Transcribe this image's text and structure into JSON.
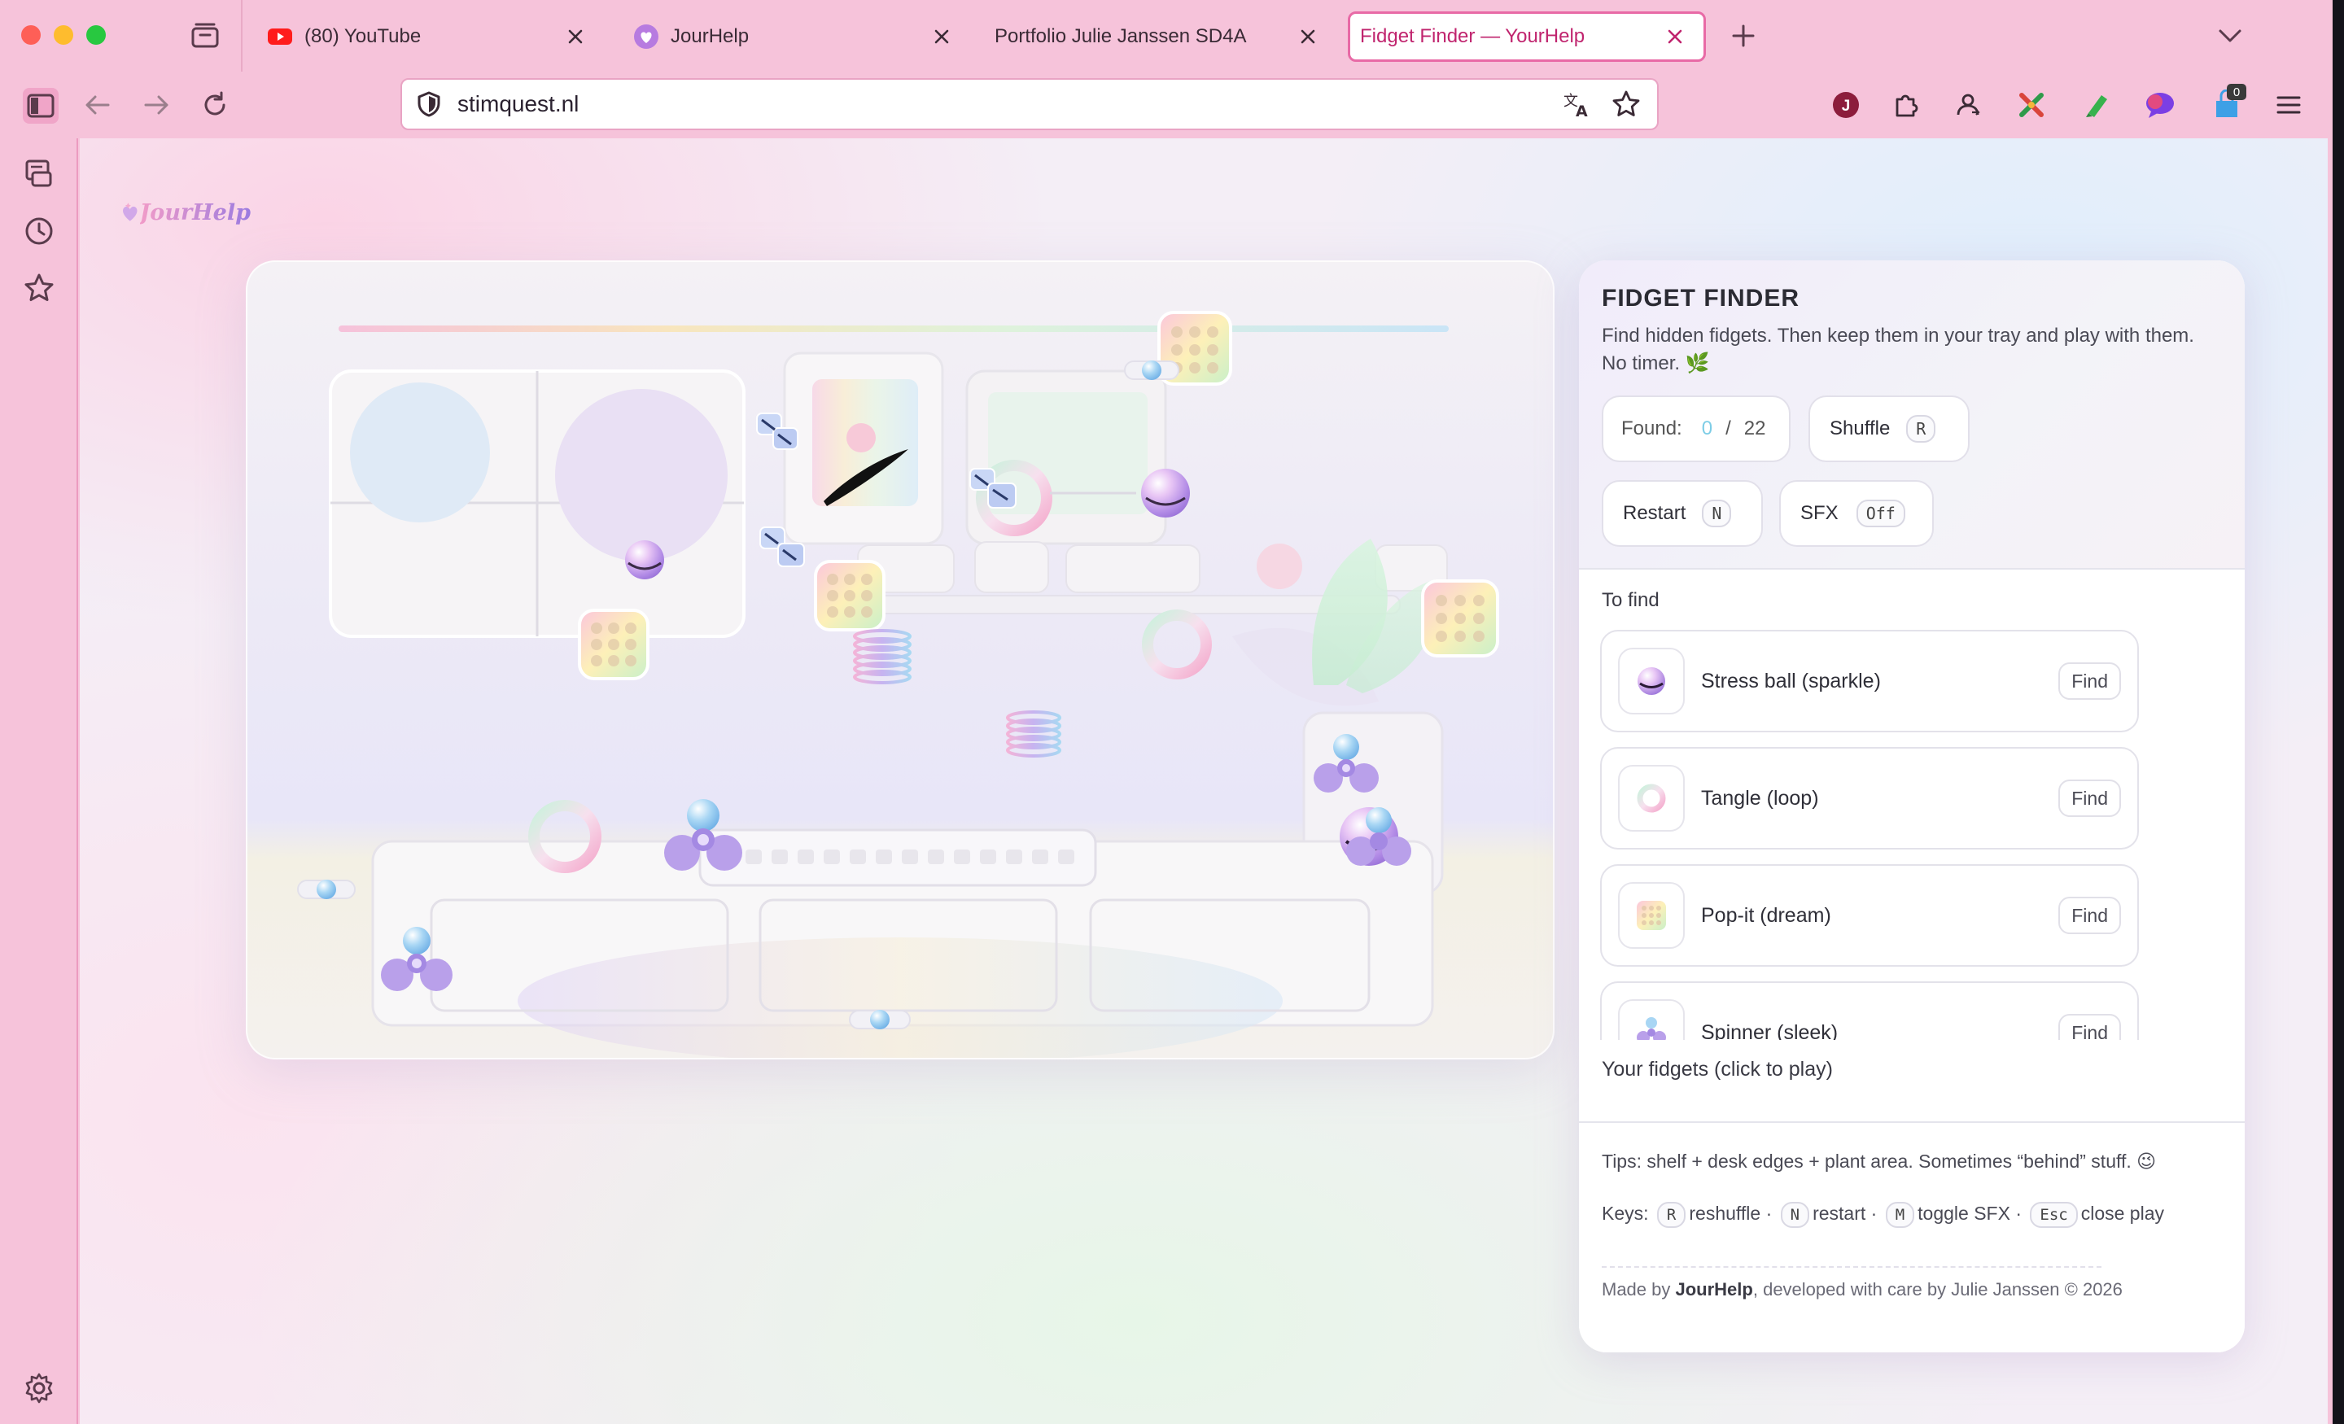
{
  "browser": {
    "tabs": [
      {
        "title": "(80) YouTube",
        "icon": "youtube-icon",
        "active": false
      },
      {
        "title": "JourHelp",
        "icon": "heart-icon",
        "active": false
      },
      {
        "title": "Portfolio Julie Janssen SD4A",
        "icon": "",
        "active": false
      },
      {
        "title": "Fidget Finder — YourHelp",
        "icon": "",
        "active": true
      }
    ],
    "url": "stimquest.nl",
    "extension_badge": "0",
    "accent_color": "#e86aa6",
    "chrome_color": "#f6c3da"
  },
  "page": {
    "logo_text": "JourHelp"
  },
  "panel": {
    "title": "FIDGET FINDER",
    "description": "Find hidden fidgets. Then keep them in your tray and play with them. No timer. 🌿",
    "found_label": "Found:",
    "found_count": "0",
    "found_sep": "/",
    "found_total": "22",
    "shuffle_label": "Shuffle",
    "shuffle_key": "R",
    "restart_label": "Restart",
    "restart_key": "N",
    "sfx_label": "SFX",
    "sfx_value": "Off",
    "to_find_label": "To find",
    "items": [
      {
        "name": "Stress ball (sparkle)",
        "action": "Find",
        "icon": "stress-ball-icon"
      },
      {
        "name": "Tangle (loop)",
        "action": "Find",
        "icon": "tangle-icon"
      },
      {
        "name": "Pop-it (dream)",
        "action": "Find",
        "icon": "pop-it-icon"
      },
      {
        "name": "Spinner (sleek)",
        "action": "Find",
        "icon": "spinner-icon"
      }
    ],
    "your_fidgets_label": "Your fidgets (click to play)",
    "tips_line1": "Tips: shelf + desk edges + plant area. Sometimes “behind” stuff. 😉",
    "keys_prefix": "Keys:",
    "keys": [
      {
        "key": "R",
        "label": "reshuffle ·"
      },
      {
        "key": "N",
        "label": "restart ·"
      },
      {
        "key": "M",
        "label": "toggle SFX ·"
      },
      {
        "key": "Esc",
        "label": "close play"
      }
    ],
    "credit_prefix": "Made by ",
    "credit_brand": "JourHelp",
    "credit_suffix": ", developed with care by Julie Janssen © 2026"
  }
}
